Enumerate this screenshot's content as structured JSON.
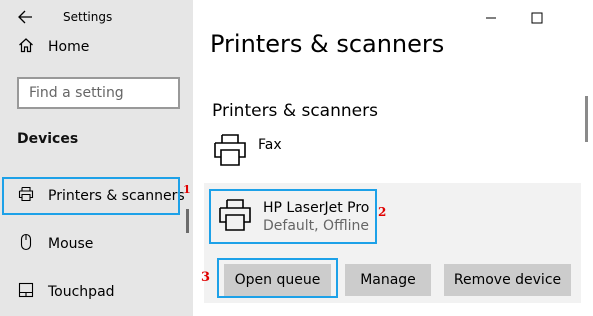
{
  "window": {
    "title": "Settings"
  },
  "sidebar": {
    "home_label": "Home",
    "search_placeholder": "Find a setting",
    "section_heading": "Devices",
    "items": [
      {
        "label": "Printers & scanners",
        "icon": "printer-icon",
        "selected": true
      },
      {
        "label": "Mouse",
        "icon": "mouse-icon"
      },
      {
        "label": "Touchpad",
        "icon": "touchpad-icon"
      }
    ]
  },
  "main": {
    "title": "Printers & scanners",
    "section_heading": "Printers & scanners",
    "devices": [
      {
        "name": "Fax",
        "status": ""
      },
      {
        "name": "HP LaserJet Pro",
        "status": "Default, Offline"
      }
    ],
    "buttons": {
      "open_queue": "Open queue",
      "manage": "Manage",
      "remove": "Remove device"
    }
  },
  "annotations": [
    "1",
    "2",
    "3"
  ],
  "colors": {
    "highlight": "#1da1e8",
    "annotation": "#e00000",
    "sidebar_bg": "#e6e6e6",
    "panel_bg": "#f2f2f2",
    "button_bg": "#cccccc"
  }
}
